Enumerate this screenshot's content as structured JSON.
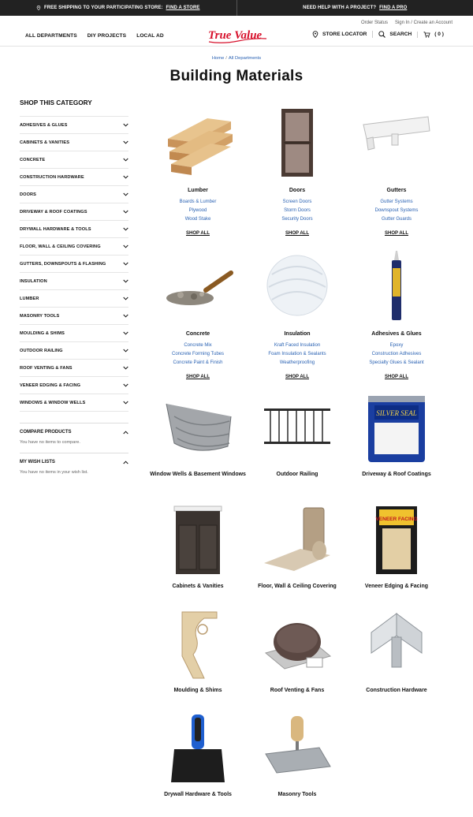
{
  "promo": {
    "left_text": "FREE SHIPPING TO YOUR PARTICIPATING STORE:",
    "left_link": "FIND A STORE",
    "right_text": "NEED HELP WITH A PROJECT?",
    "right_link": "FIND A PRO"
  },
  "util": {
    "order_status": "Order Status",
    "sign_in": "Sign In / Create an Account"
  },
  "nav": {
    "left": [
      "ALL DEPARTMENTS",
      "DIY PROJECTS",
      "LOCAL AD"
    ],
    "logo": "True Value",
    "store_locator": "STORE LOCATOR",
    "search": "SEARCH",
    "cart": "( 0 )"
  },
  "breadcrumb": {
    "home": "Home",
    "current": "All Departments"
  },
  "page_title": "Building Materials",
  "sidebar": {
    "heading": "SHOP THIS CATEGORY",
    "categories": [
      "ADHESIVES & GLUES",
      "CABINETS & VANITIES",
      "CONCRETE",
      "CONSTRUCTION HARDWARE",
      "DOORS",
      "DRIVEWAY & ROOF COATINGS",
      "DRYWALL HARDWARE & TOOLS",
      "FLOOR, WALL & CEILING COVERING",
      "GUTTERS, DOWNSPOUTS & FLASHING",
      "INSULATION",
      "LUMBER",
      "MASONRY TOOLS",
      "MOULDING & SHIMS",
      "OUTDOOR RAILING",
      "ROOF VENTING & FANS",
      "VENEER EDGING & FACING",
      "WINDOWS & WINDOW WELLS"
    ],
    "compare": {
      "title": "COMPARE PRODUCTS",
      "text": "You have no items to compare."
    },
    "wishlist": {
      "title": "MY WISH LISTS",
      "text": "You have no items in your wish list."
    }
  },
  "shop_all_label": "SHOP ALL",
  "tiles": [
    {
      "name": "Lumber",
      "subs": [
        "Boards & Lumber",
        "Plywood",
        "Wood Stake"
      ],
      "img": "lumber-image"
    },
    {
      "name": "Doors",
      "subs": [
        "Screen Doors",
        "Storm Doors",
        "Security Doors"
      ],
      "img": "door-image"
    },
    {
      "name": "Gutters",
      "subs": [
        "Gutter Systems",
        "Downspout Systems",
        "Gutter Guards"
      ],
      "img": "gutter-image"
    },
    {
      "name": "Concrete",
      "subs": [
        "Concrete Mix",
        "Concrete Forming Tubes",
        "Concrete Paint & Finish"
      ],
      "img": "concrete-image"
    },
    {
      "name": "Insulation",
      "subs": [
        "Kraft Faced Insulation",
        "Foam Insulation & Sealants",
        "Weatherproofing"
      ],
      "img": "insulation-image"
    },
    {
      "name": "Adhesives & Glues",
      "subs": [
        "Epoxy",
        "Construction Adhesives",
        "Specialty Glues & Sealant"
      ],
      "img": "adhesive-image"
    },
    {
      "name": "Window Wells & Basement Windows",
      "subs": [],
      "img": "window-well-image"
    },
    {
      "name": "Outdoor Railing",
      "subs": [],
      "img": "railing-image"
    },
    {
      "name": "Driveway & Roof Coatings",
      "subs": [],
      "img": "coating-can-image",
      "label_text": "SILVER SEAL"
    },
    {
      "name": "Cabinets & Vanities",
      "subs": [],
      "img": "vanity-image"
    },
    {
      "name": "Floor, Wall & Ceiling Covering",
      "subs": [],
      "img": "floor-roll-image"
    },
    {
      "name": "Veneer Edging & Facing",
      "subs": [],
      "img": "veneer-package-image",
      "label_text": "VENEER FACING"
    },
    {
      "name": "Moulding & Shims",
      "subs": [],
      "img": "corbel-image"
    },
    {
      "name": "Roof Venting & Fans",
      "subs": [],
      "img": "roof-vent-image"
    },
    {
      "name": "Construction Hardware",
      "subs": [],
      "img": "bracket-image"
    },
    {
      "name": "Drywall Hardware & Tools",
      "subs": [],
      "img": "taping-knife-image"
    },
    {
      "name": "Masonry Tools",
      "subs": [],
      "img": "trowel-image"
    }
  ],
  "colors": {
    "brand_red": "#d7102b",
    "link_blue": "#2a62b3",
    "promo_bg": "#222222"
  }
}
